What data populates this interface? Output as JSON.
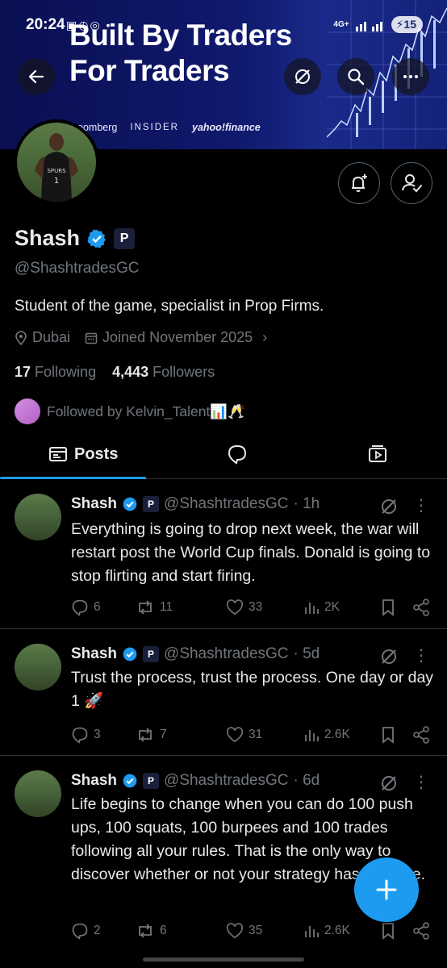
{
  "status_bar": {
    "time": "20:24",
    "icons": "▣◷◎ •",
    "network": "4G+",
    "battery": "15"
  },
  "banner": {
    "title_line1": "Built By Traders",
    "title_line2": "For Traders",
    "logos": [
      "oomberg",
      "INSIDER",
      "yahoo!finance"
    ]
  },
  "profile": {
    "name": "Shash",
    "handle": "@ShashtradesGC",
    "bio": "Student of the game, specialist in Prop Firms.",
    "location": "Dubai",
    "joined": "Joined November 2025",
    "following_count": "17",
    "following_label": "Following",
    "followers_count": "4,443",
    "followers_label": "Followers",
    "followed_by": "Followed by Kelvin_Talent📊🥂"
  },
  "tabs": [
    {
      "label": "Posts",
      "active": true
    },
    {
      "label": "",
      "icon": "reply-icon"
    },
    {
      "label": "",
      "icon": "media-icon"
    }
  ],
  "posts": [
    {
      "name": "Shash",
      "handle": "@ShashtradesGC",
      "time": "· 1h",
      "text": "Everything is going to drop next week, the war will restart post the World Cup finals. Donald is going to stop flirting and start firing.",
      "replies": "6",
      "reposts": "11",
      "likes": "33",
      "views": "2K"
    },
    {
      "name": "Shash",
      "handle": "@ShashtradesGC",
      "time": "· 5d",
      "text": "Trust the process, trust the process. One day or day 1 🚀",
      "replies": "3",
      "reposts": "7",
      "likes": "31",
      "views": "2.6K"
    },
    {
      "name": "Shash",
      "handle": "@ShashtradesGC",
      "time": "· 6d",
      "text": "Life begins to change when you can do 100 push ups, 100 squats, 100 burpees and 100 trades following all your rules. That is the only way to discover whether or not your strategy has an edge.",
      "replies": "2",
      "reposts": "6",
      "likes": "35",
      "views": "2.6K"
    }
  ],
  "colors": {
    "accent": "#1d9bf0",
    "muted": "#71767b",
    "text": "#e7e9ea",
    "border": "#2f3336"
  }
}
